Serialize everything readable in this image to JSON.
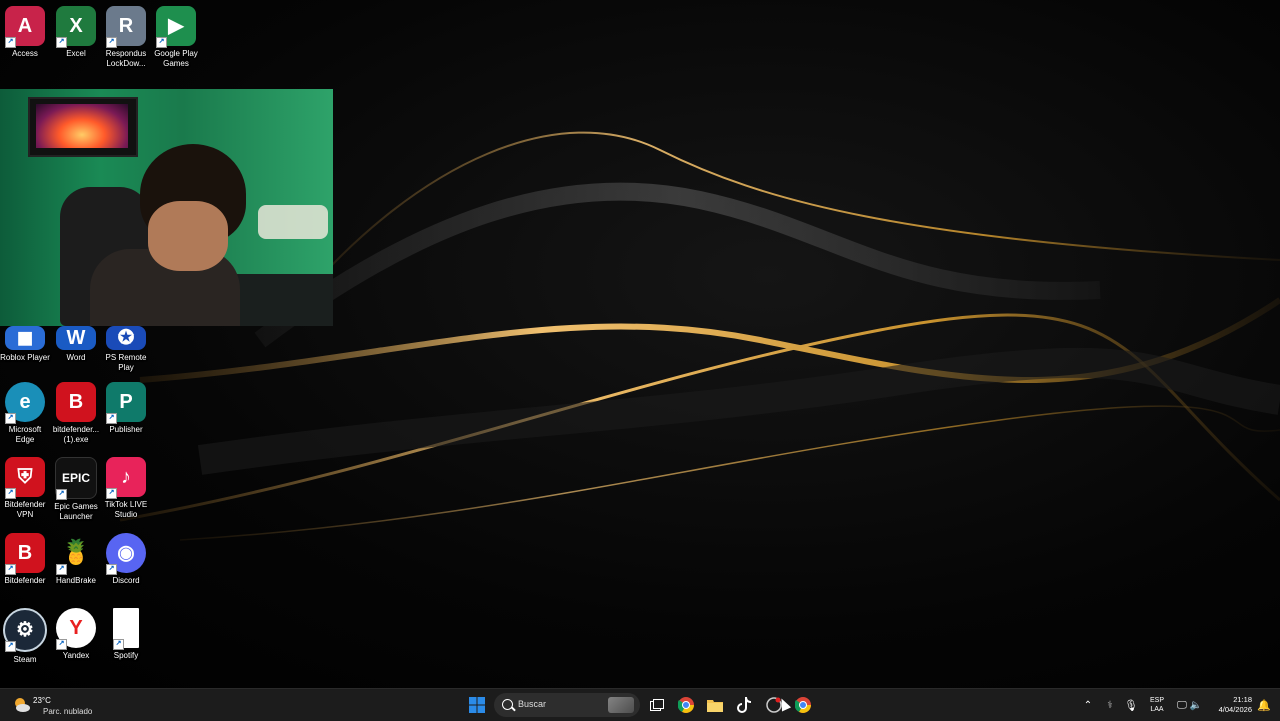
{
  "desktop": {
    "icons": [
      {
        "id": "access",
        "label": "Access",
        "letter": "A",
        "color": "#c8234a"
      },
      {
        "id": "excel",
        "label": "Excel",
        "letter": "X",
        "color": "#1f7a3e"
      },
      {
        "id": "respondus",
        "label": "Respondus LockDow...",
        "letter": "R",
        "color": "#6b7a8c"
      },
      {
        "id": "google-play-games",
        "label": "Google Play Games",
        "letter": "▶",
        "color": "#1e8f4e"
      },
      {
        "id": "roblox",
        "label": "Roblox Player",
        "letter": "◼",
        "color": "#2a6cd6"
      },
      {
        "id": "word",
        "label": "Word",
        "letter": "W",
        "color": "#1a5bc4"
      },
      {
        "id": "ps-remote",
        "label": "PS Remote Play",
        "letter": "✪",
        "color": "#1a4bb8"
      },
      {
        "id": "edge",
        "label": "Microsoft Edge",
        "letter": "e",
        "color": "#1a8fb8"
      },
      {
        "id": "bitdefender-exe",
        "label": "bitdefender... (1).exe",
        "letter": "B",
        "color": "#d0121e"
      },
      {
        "id": "publisher",
        "label": "Publisher",
        "letter": "P",
        "color": "#0f7a6a"
      },
      {
        "id": "bitdefender-vpn",
        "label": "Bitdefender VPN",
        "letter": "⛨",
        "color": "#d0121e"
      },
      {
        "id": "epic-games",
        "label": "Epic Games Launcher",
        "letter": "EPIC",
        "color": "#111111"
      },
      {
        "id": "tiktok-live",
        "label": "TikTok LIVE Studio",
        "letter": "♪",
        "color": "#e8235a"
      },
      {
        "id": "bitdefender",
        "label": "Bitdefender",
        "letter": "B",
        "color": "#d0121e"
      },
      {
        "id": "handbrake",
        "label": "HandBrake",
        "letter": "🍍",
        "color": "#6a3a1a"
      },
      {
        "id": "discord",
        "label": "Discord",
        "letter": "◉",
        "color": "#5865f2"
      },
      {
        "id": "steam",
        "label": "Steam",
        "letter": "⚙",
        "color": "#1b2838"
      },
      {
        "id": "yandex",
        "label": "Yandex",
        "letter": "Y",
        "color": "#ffffff"
      },
      {
        "id": "spotify",
        "label": "Spotify",
        "letter": "",
        "color": "#ffffff"
      }
    ]
  },
  "taskbar": {
    "weather": {
      "temp": "23°C",
      "condition": "Parc. nublado"
    },
    "search_placeholder": "Buscar",
    "tray": {
      "lang_top": "ESP",
      "lang_bottom": "LAA"
    },
    "clock": {
      "time": "21:18",
      "date": "4/04/2026"
    }
  },
  "colors": {
    "taskbar": "#1c1c1c",
    "accent_gold": "#d4a24a",
    "start_blue": "#2b8be8"
  }
}
